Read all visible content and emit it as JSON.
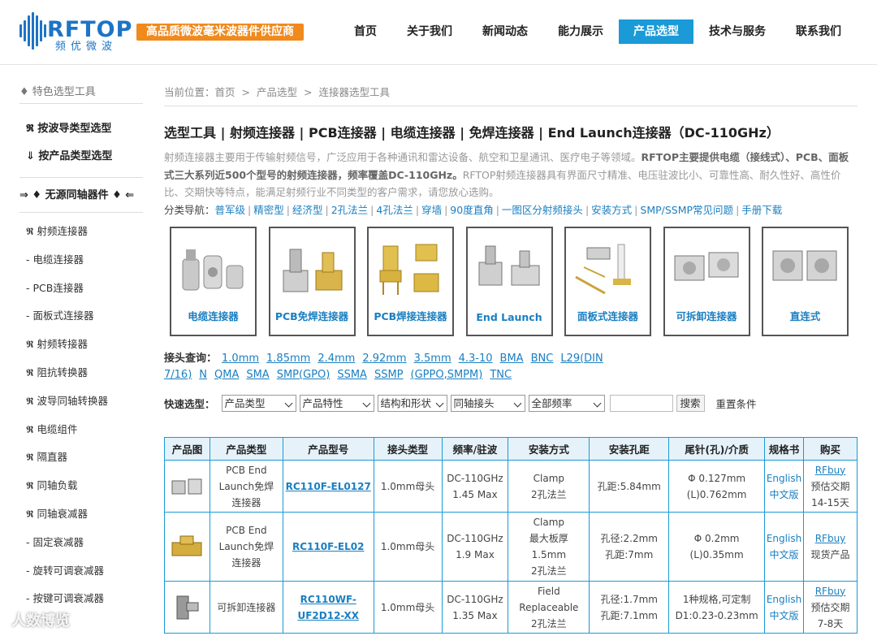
{
  "logo": {
    "text": "RFTOP",
    "sub": "频优微波",
    "slogan": "高品质微波毫米波器件供应商"
  },
  "nav": {
    "items": [
      "首页",
      "关于我们",
      "新闻动态",
      "能力展示",
      "产品选型",
      "技术与服务",
      "联系我们"
    ],
    "active_index": 4
  },
  "sidebar": {
    "head": "♦ 特色选型工具",
    "links": [
      "𝕽 按波导类型选型",
      "⇓ 按产品类型选型"
    ],
    "section": "⇒ ♦ 无源同轴器件 ♦ ⇐",
    "items": [
      "𝕽 射频连接器",
      "- 电缆连接器",
      "- PCB连接器",
      "- 面板式连接器",
      "𝕽 射频转接器",
      "𝕽 阻抗转换器",
      "𝕽 波导同轴转换器",
      "𝕽 电缆组件",
      "𝕽 隔直器",
      "𝕽 同轴负载",
      "𝕽 同轴衰减器",
      "- 固定衰减器",
      "- 旋转可调衰减器",
      "- 按键可调衰减器"
    ]
  },
  "breadcrumb": {
    "label": "当前位置：",
    "items": [
      "首页",
      "产品选型",
      "连接器选型工具"
    ],
    "sep": ">"
  },
  "title": "选型工具 | 射频连接器 | PCB连接器 | 电缆连接器 | 免焊连接器 | End Launch连接器（DC-110GHz）",
  "desc": {
    "p1": "射频连接器主要用于传输射频信号，广泛应用于各种通讯和雷达设备、航空和卫星通讯、医疗电子等领域。",
    "p2": "RFTOP主要提供电缆（接线式）、PCB、面板式三大系列近500个型号的射频连接器，频率覆盖DC-110GHz。",
    "p3": "RFTOP射频连接器具有界面尺寸精准、电压驻波比小、可靠性高、耐久性好、高性价比、交期快等特点，能满足射频行业不同类型的客户需求，请您放心选购。"
  },
  "catnav": {
    "label": "分类导航：",
    "items": [
      "普军级",
      "精密型",
      "经济型",
      "2孔法兰",
      "4孔法兰",
      "穿墙",
      "90度直角",
      "一图区分射频接头",
      "安装方式",
      "SMP/SSMP常见问题",
      "手册下载"
    ]
  },
  "cards": [
    "电缆连接器",
    "PCB免焊连接器",
    "PCB焊接连接器",
    "End Launch",
    "面板式连接器",
    "可拆卸连接器",
    "直连式"
  ],
  "iface": {
    "label": "接头查询：",
    "items": [
      "1.0mm",
      "1.85mm",
      "2.4mm",
      "2.92mm",
      "3.5mm",
      "4.3-10",
      "BMA",
      "BNC",
      "L29(DIN 7/16)",
      "N",
      "QMA",
      "SMA",
      "SMP(GPO)",
      "SSMA",
      "SSMP",
      "(GPPO,SMPM)",
      "TNC"
    ]
  },
  "quick": {
    "label": "快速选型：",
    "selects": [
      "产品类型",
      "产品特性",
      "结构和形状",
      "同轴接头",
      "全部频率"
    ],
    "search": "搜索",
    "reset": "重置条件"
  },
  "table": {
    "headers": [
      "产品图",
      "产品类型",
      "产品型号",
      "接头类型",
      "频率/驻波",
      "安装方式",
      "安装孔距",
      "尾针(孔)/介质",
      "规格书",
      "购买"
    ],
    "rows": [
      {
        "type": [
          "PCB End",
          "Launch免焊",
          "连接器"
        ],
        "model": "RC110F-EL0127",
        "conn": "1.0mm母头",
        "freq": [
          "DC-110GHz",
          "1.45 Max"
        ],
        "mount": [
          "Clamp",
          "2孔法兰"
        ],
        "hole": [
          "孔距:5.84mm"
        ],
        "pin": [
          "Φ 0.127mm",
          "(L)0.762mm"
        ],
        "spec": [
          "English",
          "中文版"
        ],
        "buy": [
          "RFbuy",
          "预估交期",
          "14-15天"
        ]
      },
      {
        "type": [
          "PCB End",
          "Launch免焊",
          "连接器"
        ],
        "model": "RC110F-EL02",
        "conn": "1.0mm母头",
        "freq": [
          "DC-110GHz",
          "1.9 Max"
        ],
        "mount": [
          "Clamp",
          "最大板厚",
          "1.5mm",
          "2孔法兰"
        ],
        "hole": [
          "孔径:2.2mm",
          "孔距:7mm"
        ],
        "pin": [
          "Φ 0.2mm",
          "(L)0.35mm"
        ],
        "spec": [
          "English",
          "中文版"
        ],
        "buy": [
          "RFbuy",
          "现货产品"
        ]
      },
      {
        "type": [
          "可拆卸连接器"
        ],
        "model": [
          "RC110WF-",
          "UF2D12-XX"
        ],
        "conn": "1.0mm母头",
        "freq": [
          "DC-110GHz",
          "1.35 Max"
        ],
        "mount": [
          "Field",
          "Replaceable",
          "2孔法兰"
        ],
        "hole": [
          "孔径:1.7mm",
          "孔距:7.1mm"
        ],
        "pin": [
          "1种规格,可定制",
          "D1:0.23-0.23mm"
        ],
        "spec": [
          "English",
          "中文版"
        ],
        "buy": [
          "RFbuy",
          "预估交期",
          "7-8天"
        ]
      }
    ]
  },
  "watermark": "人数博览",
  "colors": {
    "brand": "#1d74c6",
    "nav_active": "#1a9ad6",
    "slogan_bg": "#f08a1c",
    "link": "#1a7fc1"
  }
}
